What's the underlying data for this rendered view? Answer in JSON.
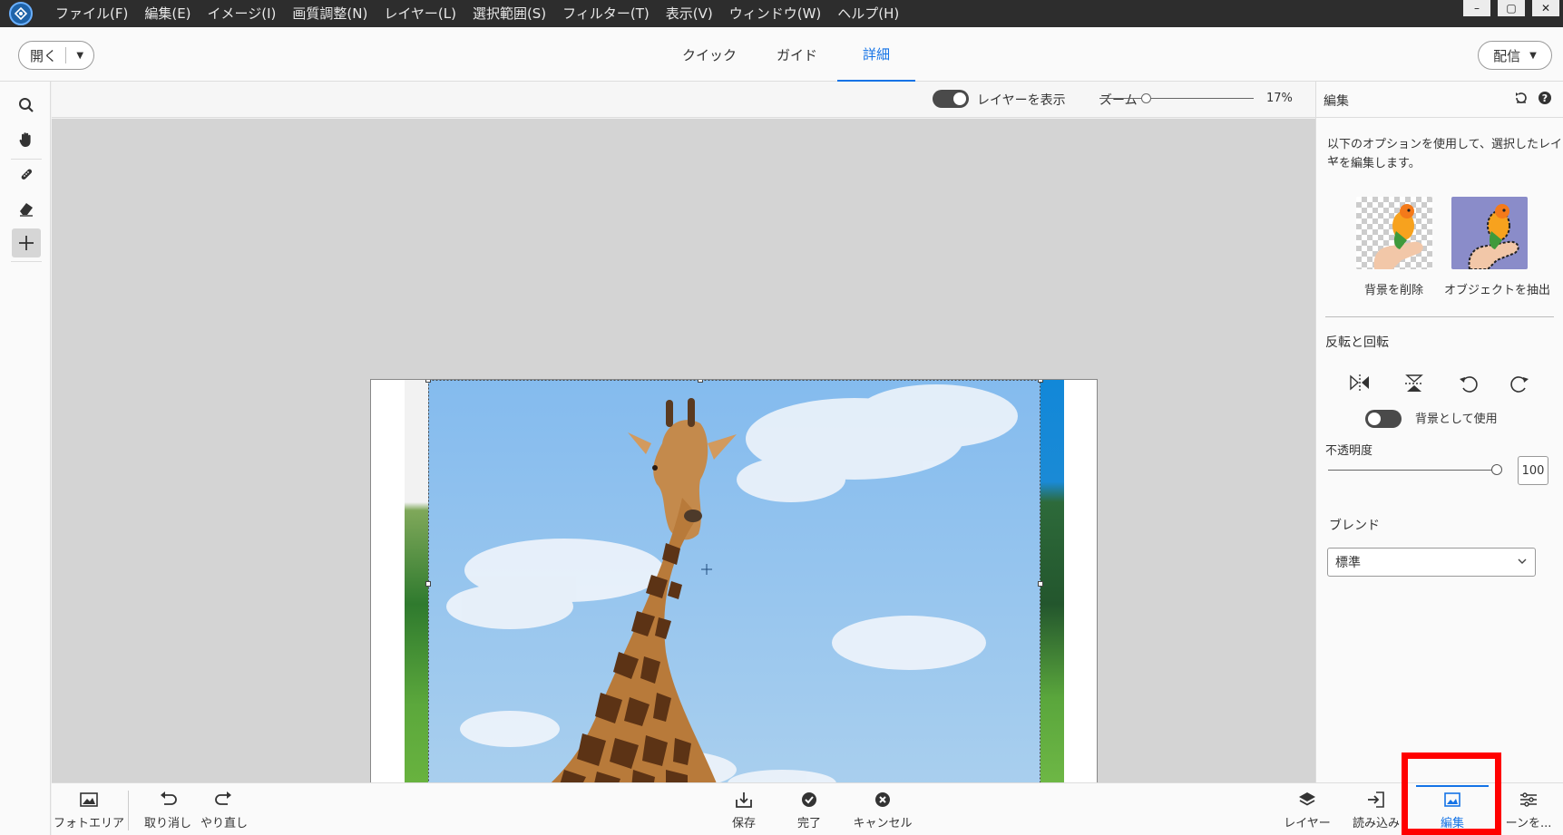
{
  "menu": {
    "items": [
      "ファイル(F)",
      "編集(E)",
      "イメージ(I)",
      "画質調整(N)",
      "レイヤー(L)",
      "選択範囲(S)",
      "フィルター(T)",
      "表示(V)",
      "ウィンドウ(W)",
      "ヘルプ(H)"
    ]
  },
  "window_controls": {
    "minimize": "–",
    "restore": "▢",
    "close": "✕"
  },
  "topbar": {
    "open_label": "開く",
    "modes": [
      "クイック",
      "ガイド",
      "詳細"
    ],
    "active_mode": "詳細",
    "share_label": "配信"
  },
  "tools": [
    "search-icon",
    "hand-icon",
    "healing-brush-icon",
    "eraser-icon",
    "move-icon"
  ],
  "options": {
    "show_layers_label": "レイヤーを表示",
    "show_layers_on": true,
    "zoom_label": "ズーム",
    "zoom_value": "17%",
    "zoom_fraction": 0.17
  },
  "panel": {
    "title": "編集",
    "description_line1": "以下のオプションを使用して、選択したレイヤ",
    "description_line2": "ーを編集します。",
    "remove_bg_label": "背景を削除",
    "extract_object_label": "オブジェクトを抽出",
    "flip_rotate_label": "反転と回転",
    "use_as_bg_label": "背景として使用",
    "use_as_bg_on": false,
    "opacity_label": "不透明度",
    "opacity_value": "100",
    "blend_label": "ブレンド",
    "blend_value": "標準"
  },
  "bottom": {
    "photo_area": "フォトエリア",
    "undo": "取り消し",
    "redo": "やり直し",
    "save": "保存",
    "done": "完了",
    "cancel": "キャンセル",
    "layers": "レイヤー",
    "import": "読み込み",
    "edit": "編集",
    "adjust": "ーンを..."
  },
  "colors": {
    "accent": "#1473e6",
    "highlight": "#ff0000",
    "menubar_bg": "#2d2d2d"
  }
}
